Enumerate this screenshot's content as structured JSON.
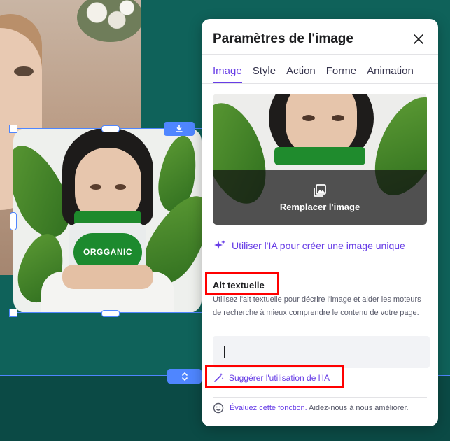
{
  "panel": {
    "title": "Paramètres de l'image",
    "tabs": [
      {
        "label": "Image",
        "active": true
      },
      {
        "label": "Style",
        "active": false
      },
      {
        "label": "Action",
        "active": false
      },
      {
        "label": "Forme",
        "active": false
      },
      {
        "label": "Animation",
        "active": false
      }
    ],
    "preview": {
      "replace_label": "Remplacer l'image",
      "jar_text": "ORGGANIC"
    },
    "ai_generate_link": "Utiliser l'IA pour créer une image unique",
    "alt_text": {
      "title": "Alt textuelle",
      "description": "Utilisez l'alt textuelle pour décrire l'image et aider les moteurs de recherche à mieux comprendre le contenu de votre page.",
      "value": "",
      "suggest_link": "Suggérer l'utilisation de l'IA"
    },
    "feedback": {
      "link": "Évaluez cette fonction.",
      "text": "Aidez-nous à nous améliorer."
    }
  },
  "canvas": {
    "selected_image_jar_text": "ORGGANIC"
  },
  "icons": {
    "close": "close-icon",
    "download": "download-icon",
    "updown": "chevron-updown-icon",
    "replace": "image-gallery-icon",
    "sparkle": "sparkle-icon",
    "magic_wand": "magic-wand-icon",
    "smiley": "smiley-icon"
  },
  "colors": {
    "accent": "#673de6",
    "selection": "#4f86ff",
    "highlight": "#ff0000",
    "canvas_bg": "#0f625a"
  }
}
